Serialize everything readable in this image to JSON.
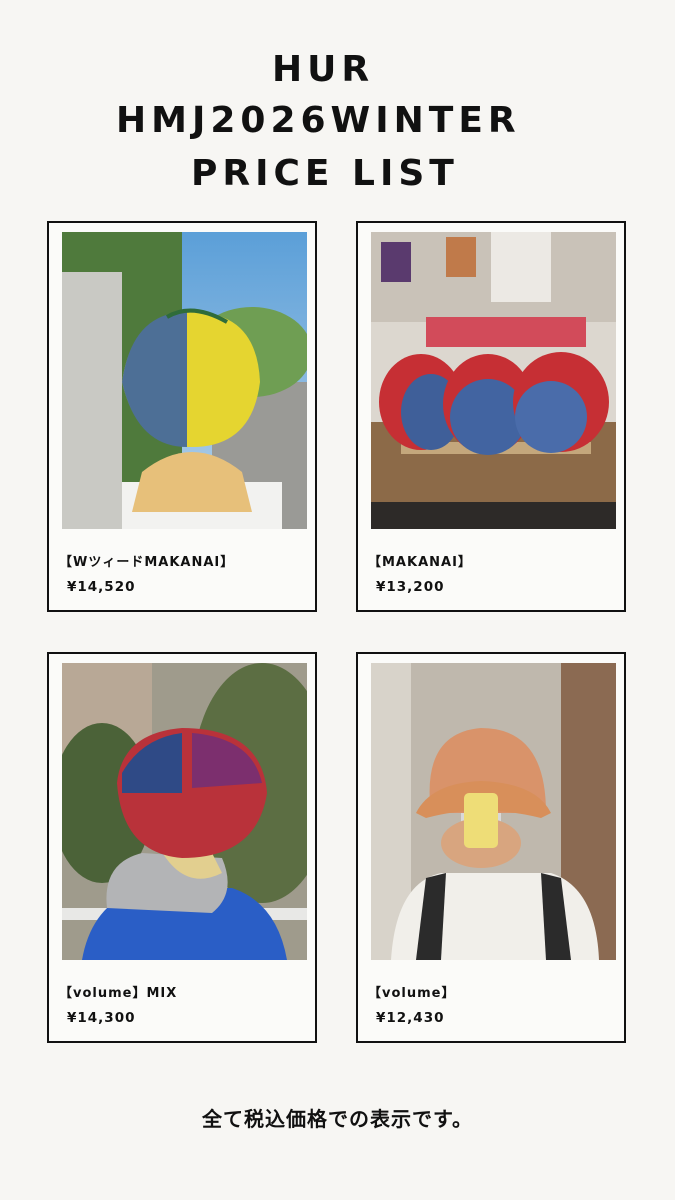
{
  "header": {
    "title_lines": [
      "HUR",
      "HMJ2026WINTER",
      "PRICE LIST"
    ]
  },
  "products": [
    {
      "name": "【WツィードMAKANAI】",
      "price": "¥14,520"
    },
    {
      "name": "【MAKANAI】",
      "price": "¥13,200"
    },
    {
      "name": "【volume】MIX",
      "price": "¥14,300"
    },
    {
      "name": "【volume】",
      "price": "¥12,430"
    }
  ],
  "footer": {
    "note": "全て税込価格での表示です。"
  },
  "colors": {
    "background": "#f7f6f3",
    "text": "#111111",
    "card_border": "#111111"
  }
}
